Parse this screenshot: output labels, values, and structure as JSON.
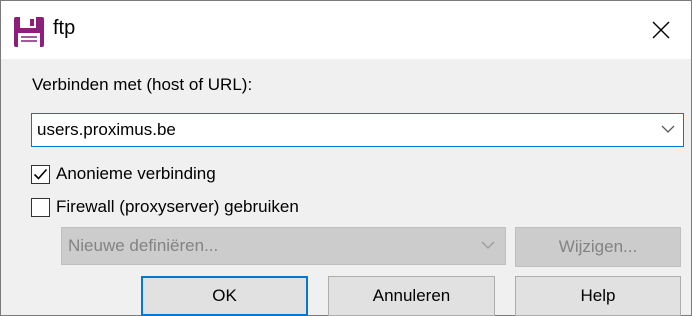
{
  "window": {
    "title": "ftp",
    "icons": {
      "title": "floppy-disk-icon",
      "close": "close-icon"
    },
    "colors": {
      "accent": "#0078d7",
      "icon_purple": "#8b1f7a"
    }
  },
  "form": {
    "host_label": "Verbinden met (host of URL):",
    "host_value": "users.proximus.be",
    "anonymous_label": "Anonieme verbinding",
    "anonymous_checked": true,
    "firewall_label": "Firewall (proxyserver) gebruiken",
    "firewall_checked": false,
    "proxy_value": "Nieuwe definiëren...",
    "change_label": "Wijzigen..."
  },
  "buttons": {
    "ok": "OK",
    "cancel": "Annuleren",
    "help": "Help"
  }
}
